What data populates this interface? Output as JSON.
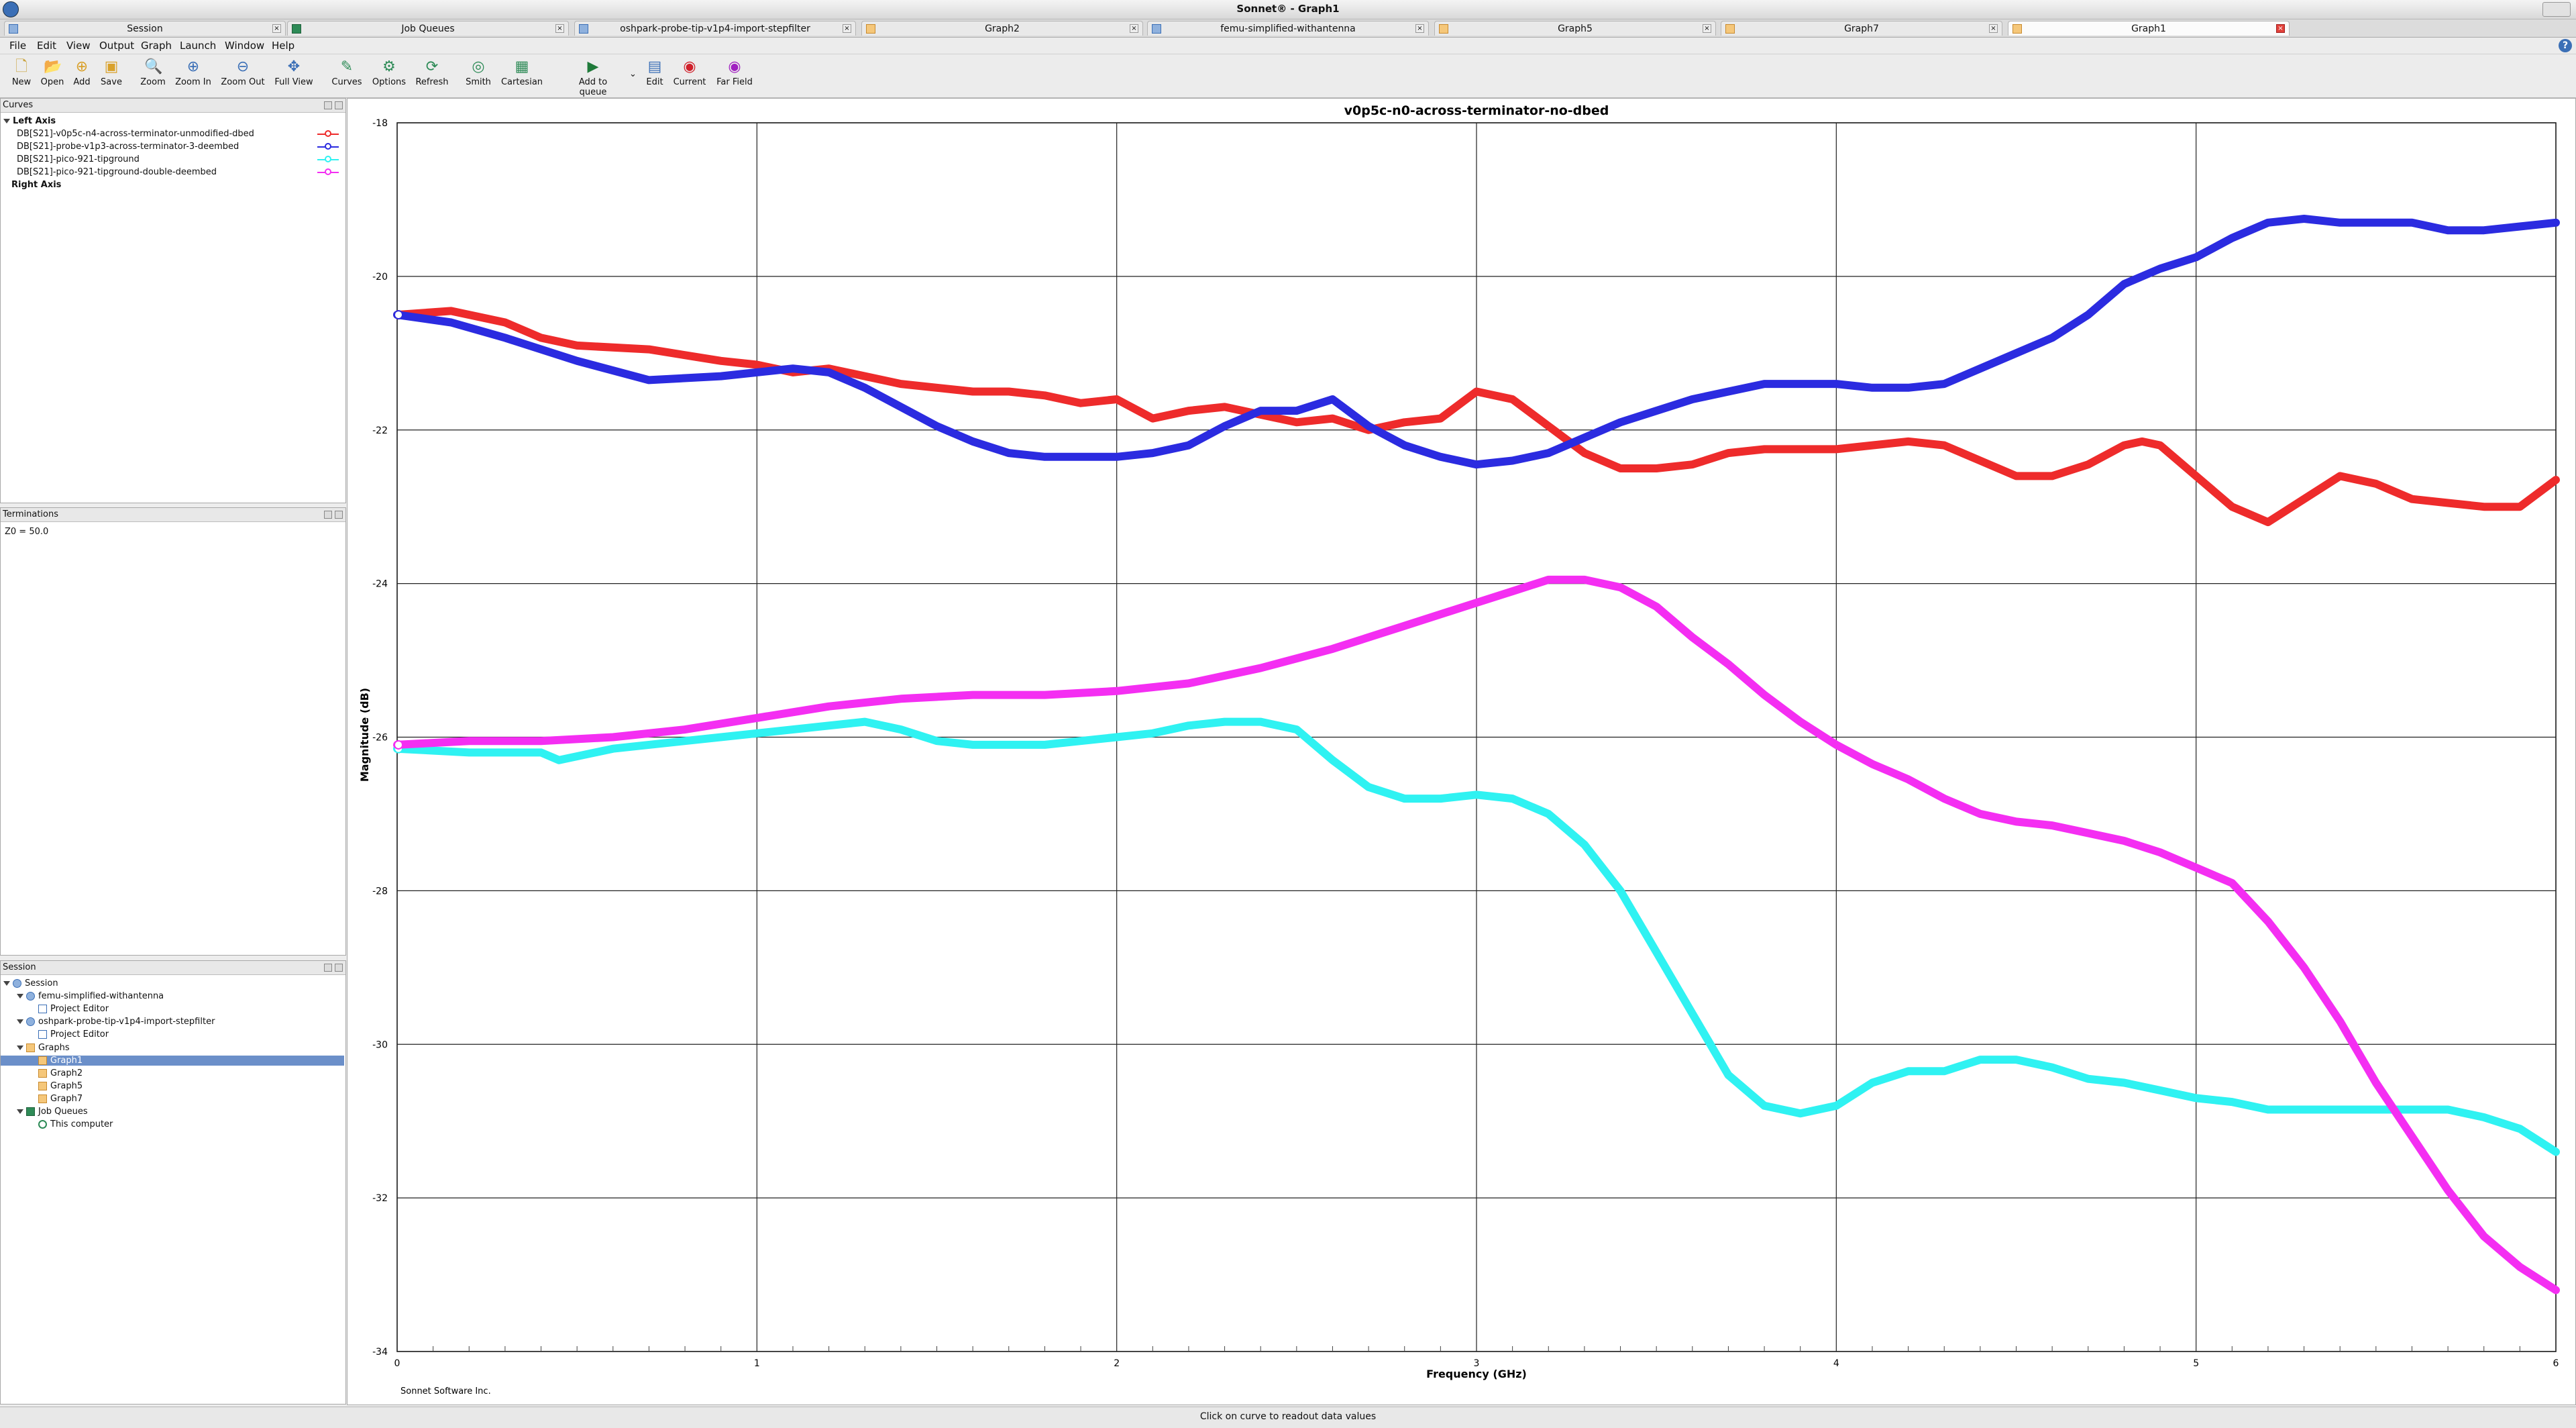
{
  "window": {
    "title": "Sonnet® - Graph1"
  },
  "tabs": [
    {
      "label": "Session",
      "icon": "session-icon",
      "active": false
    },
    {
      "label": "Job Queues",
      "icon": "queue-icon",
      "active": false
    },
    {
      "label": "oshpark-probe-tip-v1p4-import-stepfilter",
      "icon": "project-icon",
      "active": false
    },
    {
      "label": "Graph2",
      "icon": "graph-icon",
      "active": false
    },
    {
      "label": "femu-simplified-withantenna",
      "icon": "project-icon",
      "active": false
    },
    {
      "label": "Graph5",
      "icon": "graph-icon",
      "active": false
    },
    {
      "label": "Graph7",
      "icon": "graph-icon",
      "active": false
    },
    {
      "label": "Graph1",
      "icon": "graph-icon",
      "active": true
    }
  ],
  "menu": [
    "File",
    "Edit",
    "View",
    "Output",
    "Graph",
    "Launch",
    "Window",
    "Help"
  ],
  "toolbar": [
    {
      "label": "New",
      "icon": "new-icon"
    },
    {
      "label": "Open",
      "icon": "open-icon"
    },
    {
      "label": "Add",
      "icon": "add-icon"
    },
    {
      "label": "Save",
      "icon": "save-icon"
    },
    {
      "label": "Zoom",
      "icon": "zoom-icon"
    },
    {
      "label": "Zoom In",
      "icon": "zoom-in-icon"
    },
    {
      "label": "Zoom Out",
      "icon": "zoom-out-icon"
    },
    {
      "label": "Full View",
      "icon": "full-view-icon"
    },
    {
      "label": "Curves",
      "icon": "curves-icon"
    },
    {
      "label": "Options",
      "icon": "options-icon"
    },
    {
      "label": "Refresh",
      "icon": "refresh-icon"
    },
    {
      "label": "Smith",
      "icon": "smith-icon"
    },
    {
      "label": "Cartesian",
      "icon": "cartesian-icon"
    },
    {
      "label": "Add to queue",
      "icon": "add-to-queue-icon"
    },
    {
      "label": "Edit",
      "icon": "edit-icon"
    },
    {
      "label": "Current",
      "icon": "current-icon"
    },
    {
      "label": "Far Field",
      "icon": "far-field-icon"
    }
  ],
  "curves_panel": {
    "title": "Curves",
    "left_axis": "Left Axis",
    "right_axis": "Right Axis",
    "items": [
      {
        "label": "DB[S21]-v0p5c-n4-across-terminator-unmodified-dbed",
        "color": "#ee2b2b"
      },
      {
        "label": "DB[S21]-probe-v1p3-across-terminator-3-deembed",
        "color": "#2b2be0"
      },
      {
        "label": "DB[S21]-pico-921-tipground",
        "color": "#2ff2f2"
      },
      {
        "label": "DB[S21]-pico-921-tipground-double-deembed",
        "color": "#f42ef2"
      }
    ]
  },
  "terminations_panel": {
    "title": "Terminations",
    "text": "Z0 = 50.0"
  },
  "session_panel": {
    "title": "Session",
    "tree": [
      {
        "label": "Session",
        "level": 0,
        "expander": true,
        "icon": "session-icon"
      },
      {
        "label": "femu-simplified-withantenna",
        "level": 1,
        "expander": true,
        "icon": "project-icon"
      },
      {
        "label": "Project Editor",
        "level": 2,
        "expander": false,
        "icon": "editor-icon"
      },
      {
        "label": "oshpark-probe-tip-v1p4-import-stepfilter",
        "level": 1,
        "expander": true,
        "icon": "project-icon"
      },
      {
        "label": "Project Editor",
        "level": 2,
        "expander": false,
        "icon": "editor-icon"
      },
      {
        "label": "Graphs",
        "level": 1,
        "expander": true,
        "icon": "graph-folder-icon"
      },
      {
        "label": "Graph1",
        "level": 2,
        "expander": false,
        "icon": "graph-icon",
        "selected": true
      },
      {
        "label": "Graph2",
        "level": 2,
        "expander": false,
        "icon": "graph-icon"
      },
      {
        "label": "Graph5",
        "level": 2,
        "expander": false,
        "icon": "graph-icon"
      },
      {
        "label": "Graph7",
        "level": 2,
        "expander": false,
        "icon": "graph-icon"
      },
      {
        "label": "Job Queues",
        "level": 1,
        "expander": true,
        "icon": "queue-icon"
      },
      {
        "label": "This computer",
        "level": 2,
        "expander": false,
        "icon": "computer-icon"
      }
    ]
  },
  "footer_text": "Sonnet Software Inc.",
  "status": "Click on curve to readout data values",
  "chart_data": {
    "type": "line",
    "title": "v0p5c-n0-across-terminator-no-dbed",
    "xlabel": "Frequency (GHz)",
    "ylabel": "Magnitude (dB)",
    "xlim": [
      0,
      6
    ],
    "ylim": [
      -34,
      -18
    ],
    "xticks": [
      0,
      1,
      2,
      3,
      4,
      5,
      6
    ],
    "yticks": [
      -18,
      -20,
      -22,
      -24,
      -26,
      -28,
      -30,
      -32,
      -34
    ],
    "grid": true,
    "legend": "left panel",
    "series": [
      {
        "name": "DB[S21]-v0p5c-n4-across-terminator-unmodified-dbed",
        "color": "#ee2b2b",
        "x": [
          0,
          0.15,
          0.3,
          0.4,
          0.5,
          0.7,
          0.9,
          1.0,
          1.1,
          1.2,
          1.3,
          1.4,
          1.5,
          1.6,
          1.7,
          1.8,
          1.9,
          2.0,
          2.1,
          2.2,
          2.3,
          2.4,
          2.5,
          2.6,
          2.7,
          2.8,
          2.9,
          3.0,
          3.1,
          3.2,
          3.3,
          3.4,
          3.5,
          3.6,
          3.7,
          3.8,
          3.9,
          4.0,
          4.1,
          4.2,
          4.3,
          4.4,
          4.5,
          4.6,
          4.7,
          4.8,
          4.85,
          4.9,
          5.0,
          5.1,
          5.2,
          5.3,
          5.4,
          5.5,
          5.6,
          5.7,
          5.8,
          5.9,
          6.0
        ],
        "y": [
          -20.5,
          -20.45,
          -20.6,
          -20.8,
          -20.9,
          -20.95,
          -21.1,
          -21.15,
          -21.25,
          -21.2,
          -21.3,
          -21.4,
          -21.45,
          -21.5,
          -21.5,
          -21.55,
          -21.65,
          -21.6,
          -21.85,
          -21.75,
          -21.7,
          -21.8,
          -21.9,
          -21.85,
          -22.0,
          -21.9,
          -21.85,
          -21.5,
          -21.6,
          -21.95,
          -22.3,
          -22.5,
          -22.5,
          -22.45,
          -22.3,
          -22.25,
          -22.25,
          -22.25,
          -22.2,
          -22.15,
          -22.2,
          -22.4,
          -22.6,
          -22.6,
          -22.45,
          -22.2,
          -22.15,
          -22.2,
          -22.6,
          -23.0,
          -23.2,
          -22.9,
          -22.6,
          -22.7,
          -22.9,
          -22.95,
          -23.0,
          -23.0,
          -22.65
        ]
      },
      {
        "name": "DB[S21]-probe-v1p3-across-terminator-3-deembed",
        "color": "#2b2be0",
        "x": [
          0,
          0.15,
          0.3,
          0.5,
          0.7,
          0.9,
          1.0,
          1.1,
          1.2,
          1.3,
          1.4,
          1.5,
          1.6,
          1.7,
          1.8,
          1.9,
          2.0,
          2.1,
          2.2,
          2.3,
          2.4,
          2.5,
          2.6,
          2.7,
          2.8,
          2.9,
          3.0,
          3.1,
          3.2,
          3.3,
          3.4,
          3.5,
          3.6,
          3.7,
          3.8,
          3.9,
          4.0,
          4.1,
          4.2,
          4.3,
          4.4,
          4.5,
          4.6,
          4.7,
          4.8,
          4.9,
          5.0,
          5.1,
          5.2,
          5.3,
          5.4,
          5.5,
          5.6,
          5.7,
          5.8,
          5.9,
          6.0
        ],
        "y": [
          -20.5,
          -20.6,
          -20.8,
          -21.1,
          -21.35,
          -21.3,
          -21.25,
          -21.2,
          -21.25,
          -21.45,
          -21.7,
          -21.95,
          -22.15,
          -22.3,
          -22.35,
          -22.35,
          -22.35,
          -22.3,
          -22.2,
          -21.95,
          -21.75,
          -21.75,
          -21.6,
          -21.95,
          -22.2,
          -22.35,
          -22.45,
          -22.4,
          -22.3,
          -22.1,
          -21.9,
          -21.75,
          -21.6,
          -21.5,
          -21.4,
          -21.4,
          -21.4,
          -21.45,
          -21.45,
          -21.4,
          -21.2,
          -21.0,
          -20.8,
          -20.5,
          -20.1,
          -19.9,
          -19.75,
          -19.5,
          -19.3,
          -19.25,
          -19.3,
          -19.3,
          -19.3,
          -19.4,
          -19.4,
          -19.35,
          -19.3
        ]
      },
      {
        "name": "DB[S21]-pico-921-tipground",
        "color": "#2ff2f2",
        "x": [
          0,
          0.2,
          0.4,
          0.45,
          0.6,
          0.8,
          1.0,
          1.2,
          1.3,
          1.4,
          1.5,
          1.6,
          1.7,
          1.8,
          1.9,
          2.0,
          2.1,
          2.2,
          2.3,
          2.4,
          2.5,
          2.6,
          2.7,
          2.8,
          2.9,
          3.0,
          3.1,
          3.2,
          3.3,
          3.4,
          3.5,
          3.6,
          3.7,
          3.8,
          3.9,
          4.0,
          4.1,
          4.2,
          4.3,
          4.4,
          4.5,
          4.6,
          4.7,
          4.8,
          4.9,
          5.0,
          5.1,
          5.2,
          5.3,
          5.4,
          5.5,
          5.6,
          5.7,
          5.8,
          5.9,
          6.0
        ],
        "y": [
          -26.15,
          -26.2,
          -26.2,
          -26.3,
          -26.15,
          -26.05,
          -25.95,
          -25.85,
          -25.8,
          -25.9,
          -26.05,
          -26.1,
          -26.1,
          -26.1,
          -26.05,
          -26.0,
          -25.95,
          -25.85,
          -25.8,
          -25.8,
          -25.9,
          -26.3,
          -26.65,
          -26.8,
          -26.8,
          -26.75,
          -26.8,
          -27.0,
          -27.4,
          -28.0,
          -28.8,
          -29.6,
          -30.4,
          -30.8,
          -30.9,
          -30.8,
          -30.5,
          -30.35,
          -30.35,
          -30.2,
          -30.2,
          -30.3,
          -30.45,
          -30.5,
          -30.6,
          -30.7,
          -30.75,
          -30.85,
          -30.85,
          -30.85,
          -30.85,
          -30.85,
          -30.85,
          -30.95,
          -31.1,
          -31.4
        ]
      },
      {
        "name": "DB[S21]-pico-921-tipground-double-deembed",
        "color": "#f42ef2",
        "x": [
          0,
          0.2,
          0.4,
          0.6,
          0.8,
          1.0,
          1.2,
          1.4,
          1.6,
          1.8,
          2.0,
          2.2,
          2.4,
          2.6,
          2.8,
          3.0,
          3.1,
          3.2,
          3.3,
          3.4,
          3.5,
          3.6,
          3.7,
          3.8,
          3.9,
          4.0,
          4.1,
          4.2,
          4.3,
          4.4,
          4.5,
          4.6,
          4.7,
          4.8,
          4.9,
          5.0,
          5.1,
          5.2,
          5.3,
          5.4,
          5.5,
          5.6,
          5.7,
          5.8,
          5.9,
          6.0
        ],
        "y": [
          -26.1,
          -26.05,
          -26.05,
          -26.0,
          -25.9,
          -25.75,
          -25.6,
          -25.5,
          -25.45,
          -25.45,
          -25.4,
          -25.3,
          -25.1,
          -24.85,
          -24.55,
          -24.25,
          -24.1,
          -23.95,
          -23.95,
          -24.05,
          -24.3,
          -24.7,
          -25.05,
          -25.45,
          -25.8,
          -26.1,
          -26.35,
          -26.55,
          -26.8,
          -27.0,
          -27.1,
          -27.15,
          -27.25,
          -27.35,
          -27.5,
          -27.7,
          -27.9,
          -28.4,
          -29.0,
          -29.7,
          -30.5,
          -31.2,
          -31.9,
          -32.5,
          -32.9,
          -33.2
        ]
      }
    ]
  }
}
